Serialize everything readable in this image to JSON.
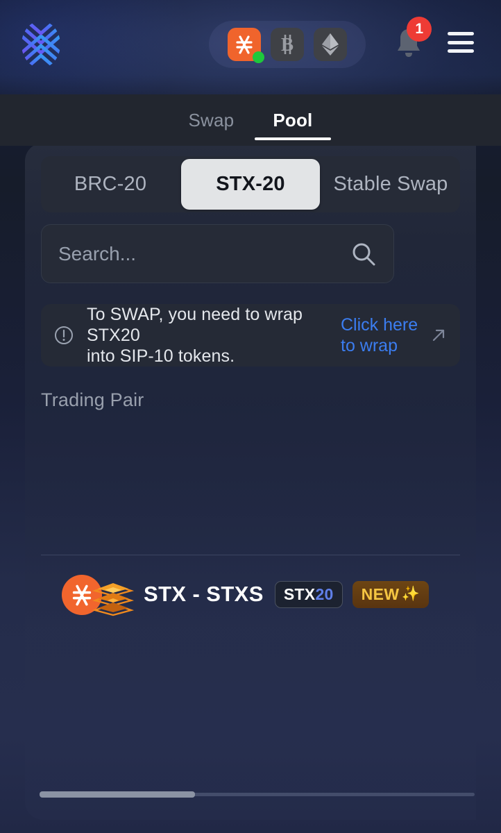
{
  "header": {
    "logo_name": "app-logo",
    "chains": [
      {
        "id": "stx",
        "label": "STX",
        "symbol": "⫯",
        "active": true,
        "color": "#f0642c"
      },
      {
        "id": "btc",
        "label": "BTC",
        "symbol": "₿",
        "active": false,
        "color": "#3f4146"
      },
      {
        "id": "eth",
        "label": "ETH",
        "symbol": "⧫",
        "active": false,
        "color": "#3f4146"
      }
    ],
    "notification_count": "1",
    "menu_label": "Menu"
  },
  "tabs": [
    {
      "label": "Swap",
      "active": false
    },
    {
      "label": "Pool",
      "active": true
    }
  ],
  "segments": [
    {
      "label": "BRC-20",
      "selected": false
    },
    {
      "label": "STX-20",
      "selected": true
    },
    {
      "label": "Stable Swap",
      "selected": false
    }
  ],
  "search": {
    "placeholder": "Search...",
    "value": ""
  },
  "banner": {
    "line1": "To SWAP, you need to wrap STX20",
    "line2": "into SIP-10 tokens.",
    "link_line1": "Click here",
    "link_line2": "to wrap",
    "link_color": "#3b7df0"
  },
  "list": {
    "column_header": "Trading Pair",
    "rows": [
      {
        "name": "STX - STXS",
        "tag_prefix": "STX",
        "tag_suffix": "20",
        "badge": "NEW",
        "badge_spark": "✨",
        "token_a": "STX",
        "token_b": "STXS"
      }
    ]
  },
  "scroll": {
    "position_label": "horizontal-scroll"
  }
}
